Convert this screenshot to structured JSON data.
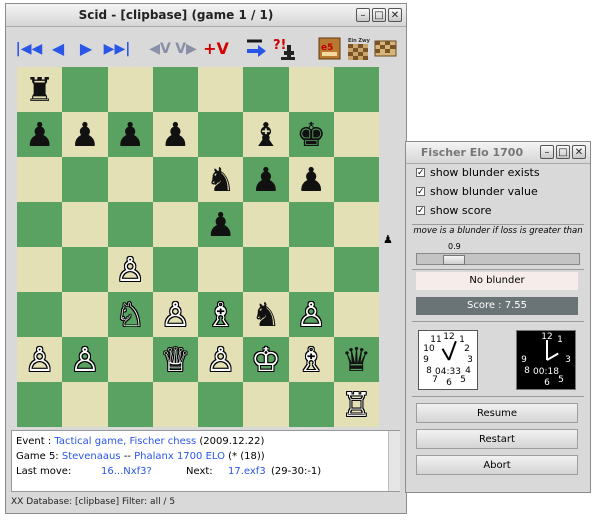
{
  "main_window": {
    "title": "Scid - [clipbase] (game 1 / 1)",
    "toolbar": {
      "first_label": "|◀◀",
      "back_label": "◀",
      "forward_label": "▶",
      "last_label": "▶▶|",
      "var_back_label": "◀V",
      "var_fwd_label": "V▶",
      "add_var_label": "+V"
    },
    "side_to_move": "♟",
    "board": {
      "rows": [
        [
          "♜",
          "",
          "",
          "",
          "",
          "",
          "",
          ""
        ],
        [
          "♟",
          "♟",
          "♟",
          "♟",
          "",
          "♝",
          "♚",
          ""
        ],
        [
          "",
          "",
          "",
          "",
          "♞",
          "♟",
          "♟",
          ""
        ],
        [
          "",
          "",
          "",
          "",
          "♟",
          "",
          "",
          ""
        ],
        [
          "",
          "",
          "♙",
          "",
          "",
          "",
          "",
          ""
        ],
        [
          "",
          "",
          "♘",
          "♙",
          "♗",
          "♞",
          "♙",
          ""
        ],
        [
          "♙",
          "♙",
          "",
          "♕",
          "♙",
          "♔",
          "♗",
          "♛"
        ],
        [
          "",
          "",
          "",
          "",
          "",
          "",
          "",
          "♖"
        ]
      ],
      "colors": [
        [
          "b",
          "",
          "",
          "",
          "",
          "",
          "",
          ""
        ],
        [
          "b",
          "b",
          "b",
          "b",
          "",
          "b",
          "b",
          ""
        ],
        [
          "",
          "",
          "",
          "",
          "b",
          "b",
          "b",
          ""
        ],
        [
          "",
          "",
          "",
          "",
          "b",
          "",
          "",
          ""
        ],
        [
          "",
          "",
          "w",
          "",
          "",
          "",
          "",
          ""
        ],
        [
          "",
          "",
          "w",
          "w",
          "w",
          "b",
          "w",
          ""
        ],
        [
          "w",
          "w",
          "",
          "w",
          "w",
          "w",
          "w",
          "b"
        ],
        [
          "",
          "",
          "",
          "",
          "",
          "",
          "",
          "w"
        ]
      ]
    },
    "info": {
      "event_label": "Event :",
      "event_value": "Tactical game, Fischer chess",
      "event_date": "(2009.12.22)",
      "game_label": "Game 5:",
      "white": "Stevenaaus",
      "vs": "--",
      "black": "Phalanx 1700 ELO",
      "result": "(* (18))",
      "last_move_label": "Last move:",
      "last_move": "16...Nxf3?",
      "next_label": "Next:",
      "next_move": "17.exf3",
      "material": "(29-30:-1)"
    },
    "status_bar": "XX  Database: [clipbase]   Filter: all / 5"
  },
  "fischer_window": {
    "title": "Fischer Elo 1700",
    "options": [
      {
        "label": "show blunder exists",
        "checked": true
      },
      {
        "label": "show blunder value",
        "checked": true
      },
      {
        "label": "show score",
        "checked": true
      }
    ],
    "blunder_threshold_label": "move is a blunder if loss is greater than",
    "slider_value": "0.9",
    "slider_fraction": 0.18,
    "blunder_status": "No blunder",
    "score_text": "Score : 7.55",
    "clock_white": "04:33",
    "clock_black": "00:18",
    "buttons": {
      "resume": "Resume",
      "restart": "Restart",
      "abort": "Abort"
    }
  },
  "colors": {
    "light_square": "#e4e0b5",
    "dark_square": "#5aa262",
    "link_blue": "#2a56e8",
    "score_bar": "#6a7376",
    "blunder_bg": "#f6ece9"
  }
}
